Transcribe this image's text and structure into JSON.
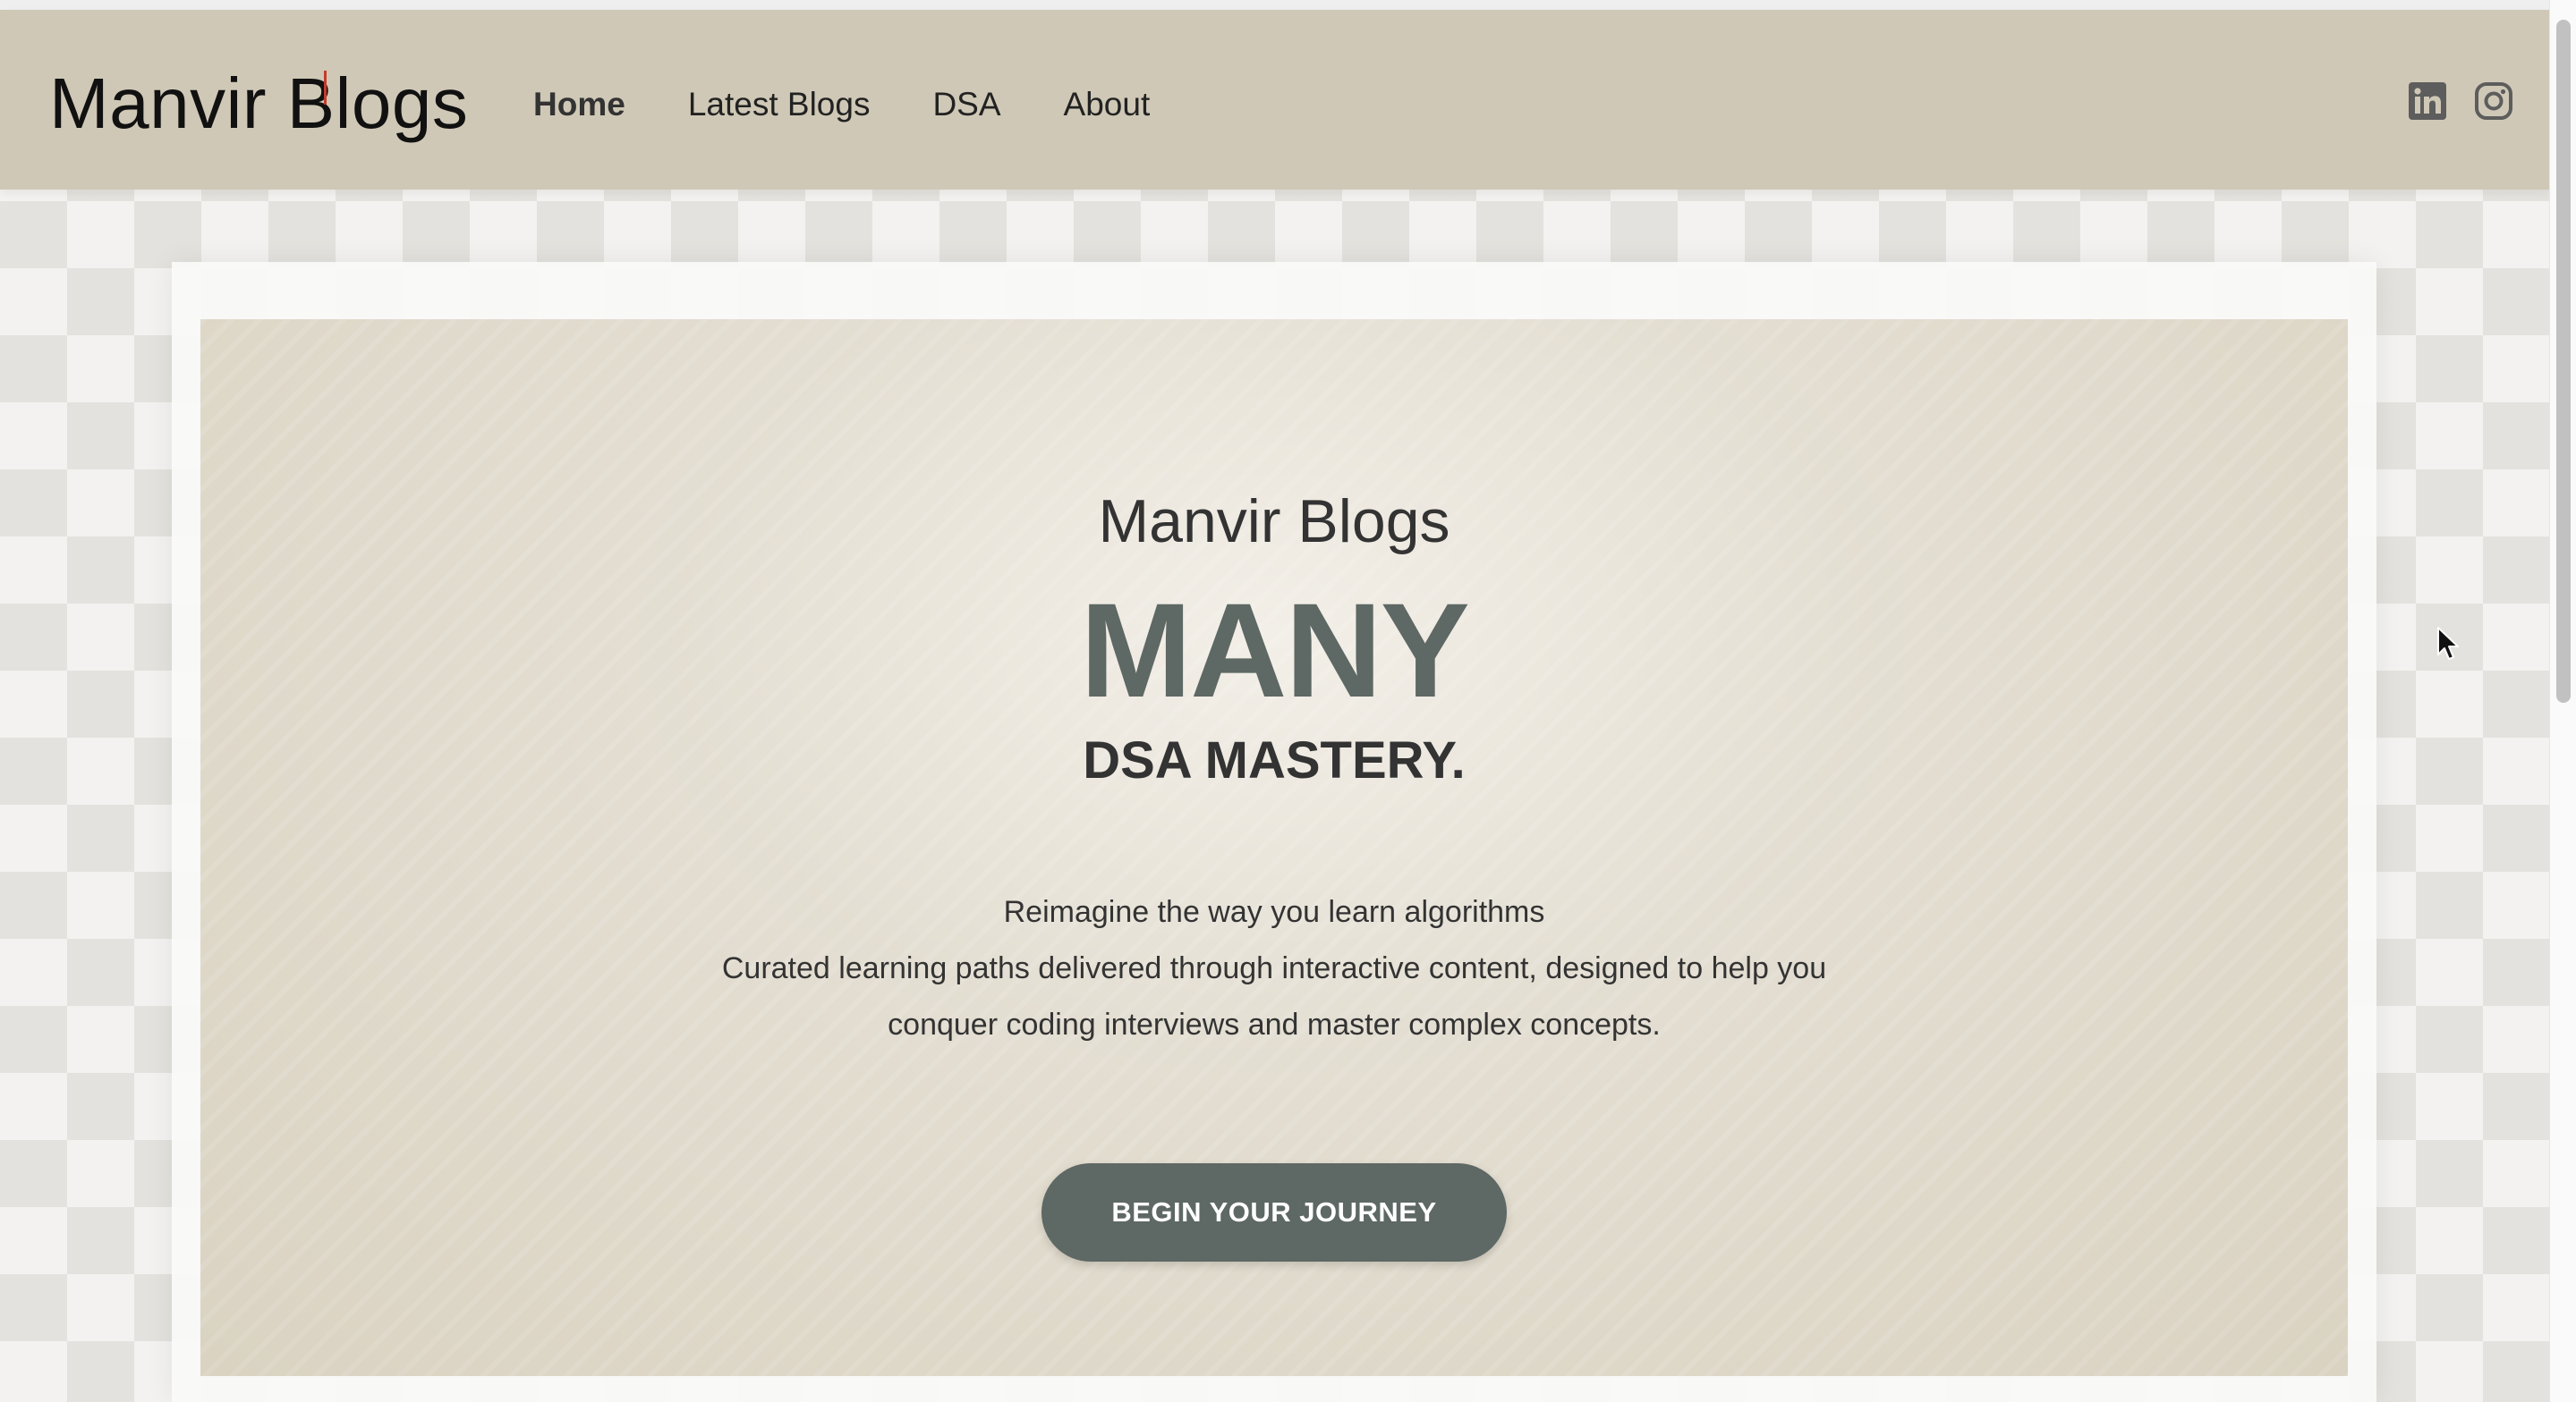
{
  "navbar": {
    "brand": "Manvir Blogs",
    "links": [
      {
        "label": "Home",
        "active": true
      },
      {
        "label": "Latest Blogs",
        "active": false
      },
      {
        "label": "DSA",
        "active": false
      },
      {
        "label": "About",
        "active": false
      }
    ],
    "social": [
      {
        "icon": "linkedin-icon"
      },
      {
        "icon": "instagram-icon"
      }
    ]
  },
  "hero": {
    "eyebrow": "Manvir Blogs",
    "title": "MANY",
    "subtitle": "DSA MASTERY.",
    "description": [
      "Reimagine the way you learn algorithms",
      "Curated learning paths delivered through interactive content, designed to help you",
      "conquer coding interviews and master complex concepts."
    ],
    "cta_label": "BEGIN YOUR JOURNEY"
  },
  "colors": {
    "navbar_bg": "#cfc8b6",
    "accent": "#5e6864",
    "hero_bg": "#dcd5c4",
    "text": "#333333"
  }
}
